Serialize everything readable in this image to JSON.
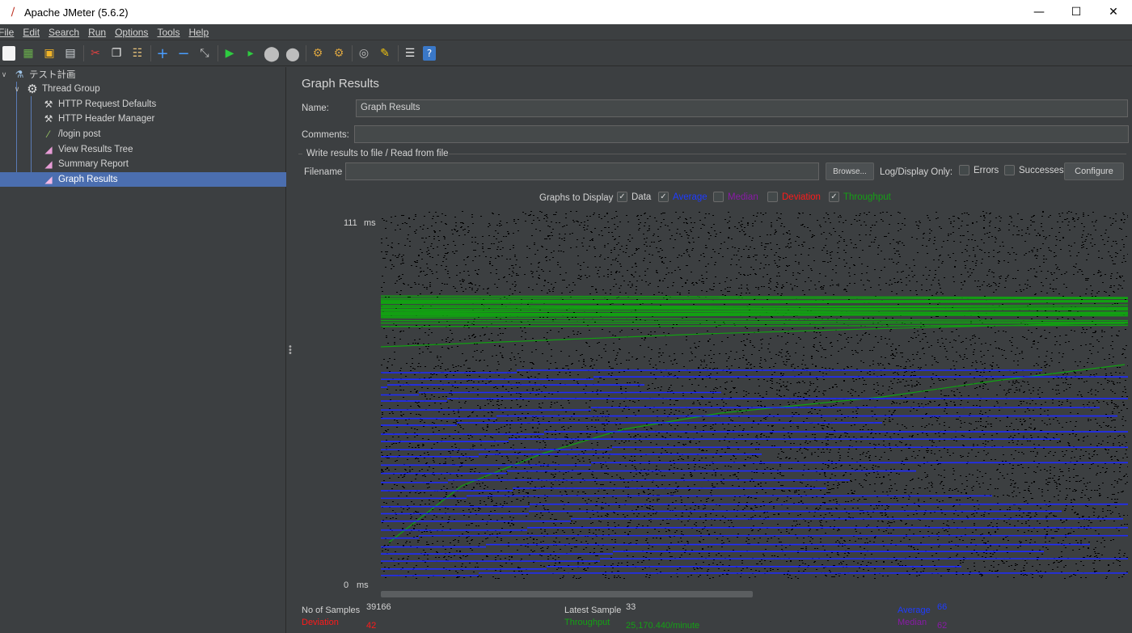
{
  "window": {
    "title": "Apache JMeter (5.6.2)",
    "minimize": "—",
    "maximize": "☐",
    "close": "✕"
  },
  "menu": [
    "File",
    "Edit",
    "Search",
    "Run",
    "Options",
    "Tools",
    "Help"
  ],
  "toolbar": {
    "icons": [
      "new-icon",
      "templates-icon",
      "open-icon",
      "save-icon",
      "cut-icon",
      "copy-icon",
      "paste-icon",
      "expand-icon",
      "collapse-icon",
      "toggle-icon",
      "start-icon",
      "start-no-pause-icon",
      "stop-icon",
      "shutdown-icon",
      "clear-icon",
      "clear-all-icon",
      "search-icon",
      "reset-search-icon",
      "function-helper-icon",
      "help-icon"
    ]
  },
  "tree": {
    "items": [
      {
        "label": "テスト計画",
        "icon": "test-plan-icon"
      },
      {
        "label": "Thread Group",
        "icon": "gear-icon"
      },
      {
        "label": "HTTP Request Defaults",
        "icon": "wrench-icon"
      },
      {
        "label": "HTTP Header Manager",
        "icon": "wrench-icon"
      },
      {
        "label": "/login post",
        "icon": "pipette-icon"
      },
      {
        "label": "View Results Tree",
        "icon": "chart-icon"
      },
      {
        "label": "Summary Report",
        "icon": "chart-icon"
      },
      {
        "label": "Graph Results",
        "icon": "chart-icon"
      }
    ]
  },
  "panel": {
    "title": "Graph Results",
    "name_label": "Name:",
    "name_value": "Graph Results",
    "comments_label": "Comments:",
    "comments_value": "",
    "file_group_label": "Write results to file / Read from file",
    "filename_label": "Filename",
    "filename_value": "",
    "browse_label": "Browse...",
    "log_display_label": "Log/Display Only:",
    "errors_label": "Errors",
    "successes_label": "Successes",
    "configure_label": "Configure",
    "graphs_to_display_label": "Graphs to Display",
    "options": [
      {
        "label": "Data",
        "checked": true,
        "color": "#d4d4d4"
      },
      {
        "label": "Average",
        "checked": true,
        "color": "#1f3cff"
      },
      {
        "label": "Median",
        "checked": false,
        "color": "#8a1aa8"
      },
      {
        "label": "Deviation",
        "checked": false,
        "color": "#ff1a1a"
      },
      {
        "label": "Throughput",
        "checked": true,
        "color": "#15a015"
      }
    ]
  },
  "graph": {
    "y_max_label": "111",
    "y_min_label": "0",
    "unit": "ms",
    "colors": {
      "data": "#000000",
      "average": "#1f2bff",
      "throughput": "#12a012"
    }
  },
  "stats": {
    "no_of_samples_label": "No of Samples",
    "no_of_samples_value": "39166",
    "deviation_label": "Deviation",
    "deviation_value": "42",
    "latest_sample_label": "Latest Sample",
    "latest_sample_value": "33",
    "throughput_label": "Throughput",
    "throughput_value": "25,170.440/minute",
    "average_label": "Average",
    "average_value": "66",
    "median_label": "Median",
    "median_value": "62"
  }
}
